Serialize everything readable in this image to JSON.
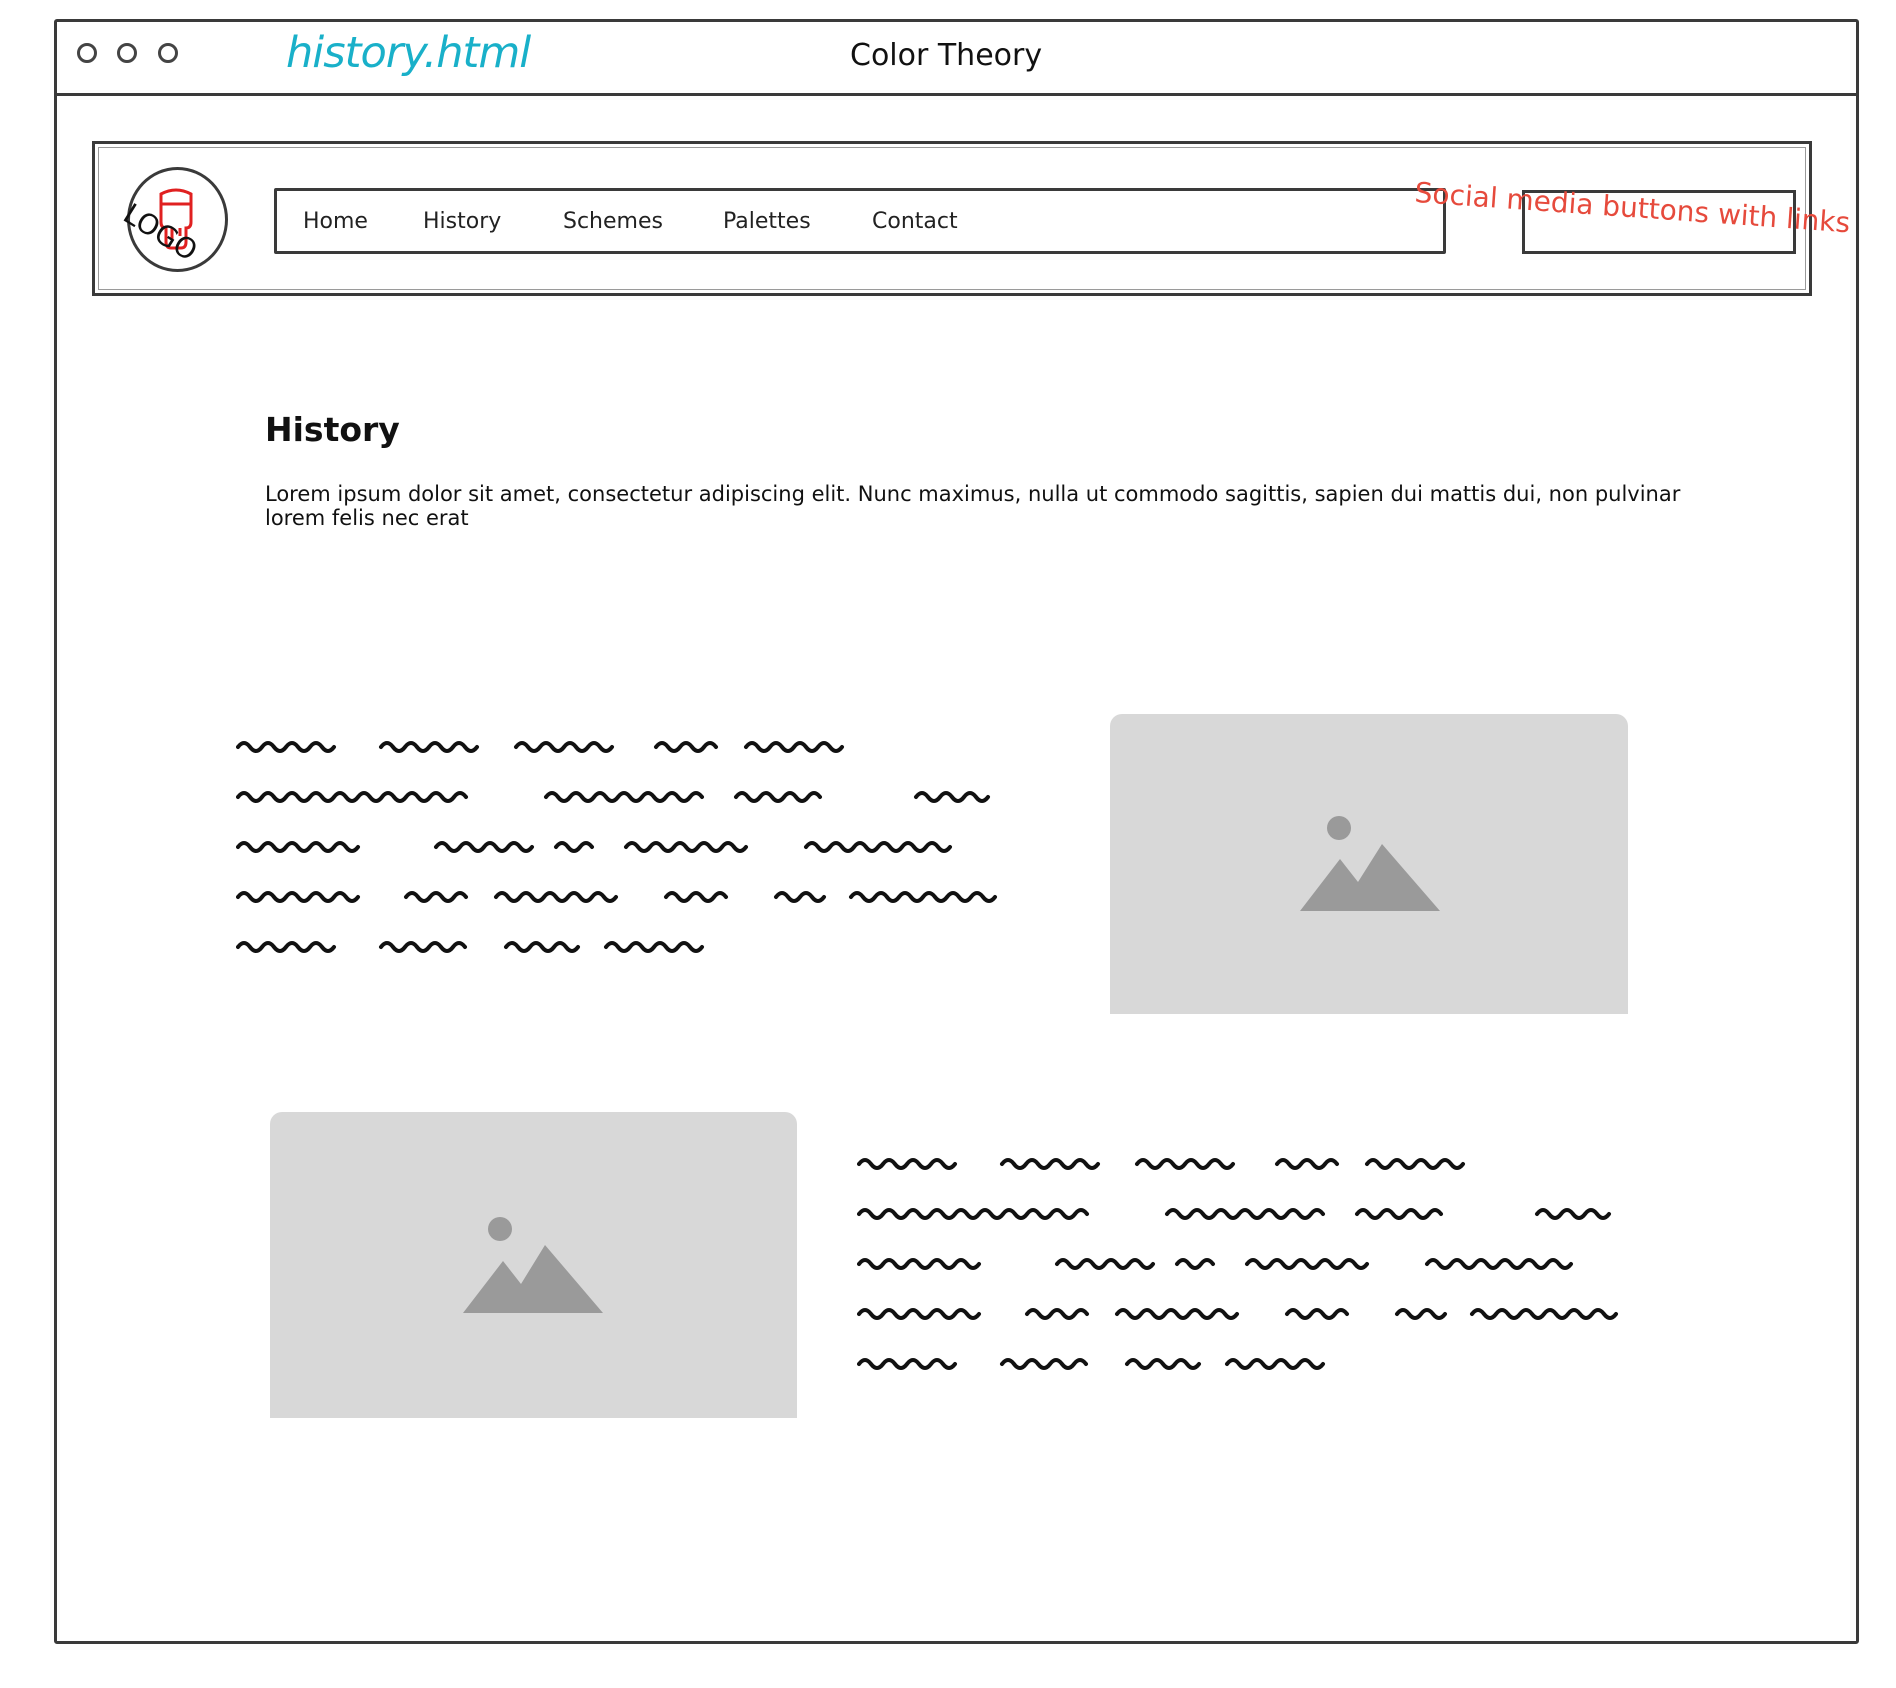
{
  "window": {
    "filename": "history.html",
    "title": "Color Theory"
  },
  "header": {
    "logo_text": "LOGO",
    "nav_items": [
      "Home",
      "History",
      "Schemes",
      "Palettes",
      "Contact"
    ],
    "social_note": "Social media buttons with links"
  },
  "main": {
    "heading": "History",
    "intro": "Lorem ipsum dolor sit amet, consectetur adipiscing elit. Nunc maximus, nulla ut commodo sagittis, sapien dui mattis dui, non pulvinar lorem felis nec erat"
  },
  "colors": {
    "filename": "#19b0c9",
    "annotation": "#e64a3c",
    "image_placeholder": "#d8d8d8",
    "image_icon": "#9a9a9a"
  },
  "icons": {
    "image_placeholder": "image-icon",
    "logo": "paint-drip-icon"
  }
}
